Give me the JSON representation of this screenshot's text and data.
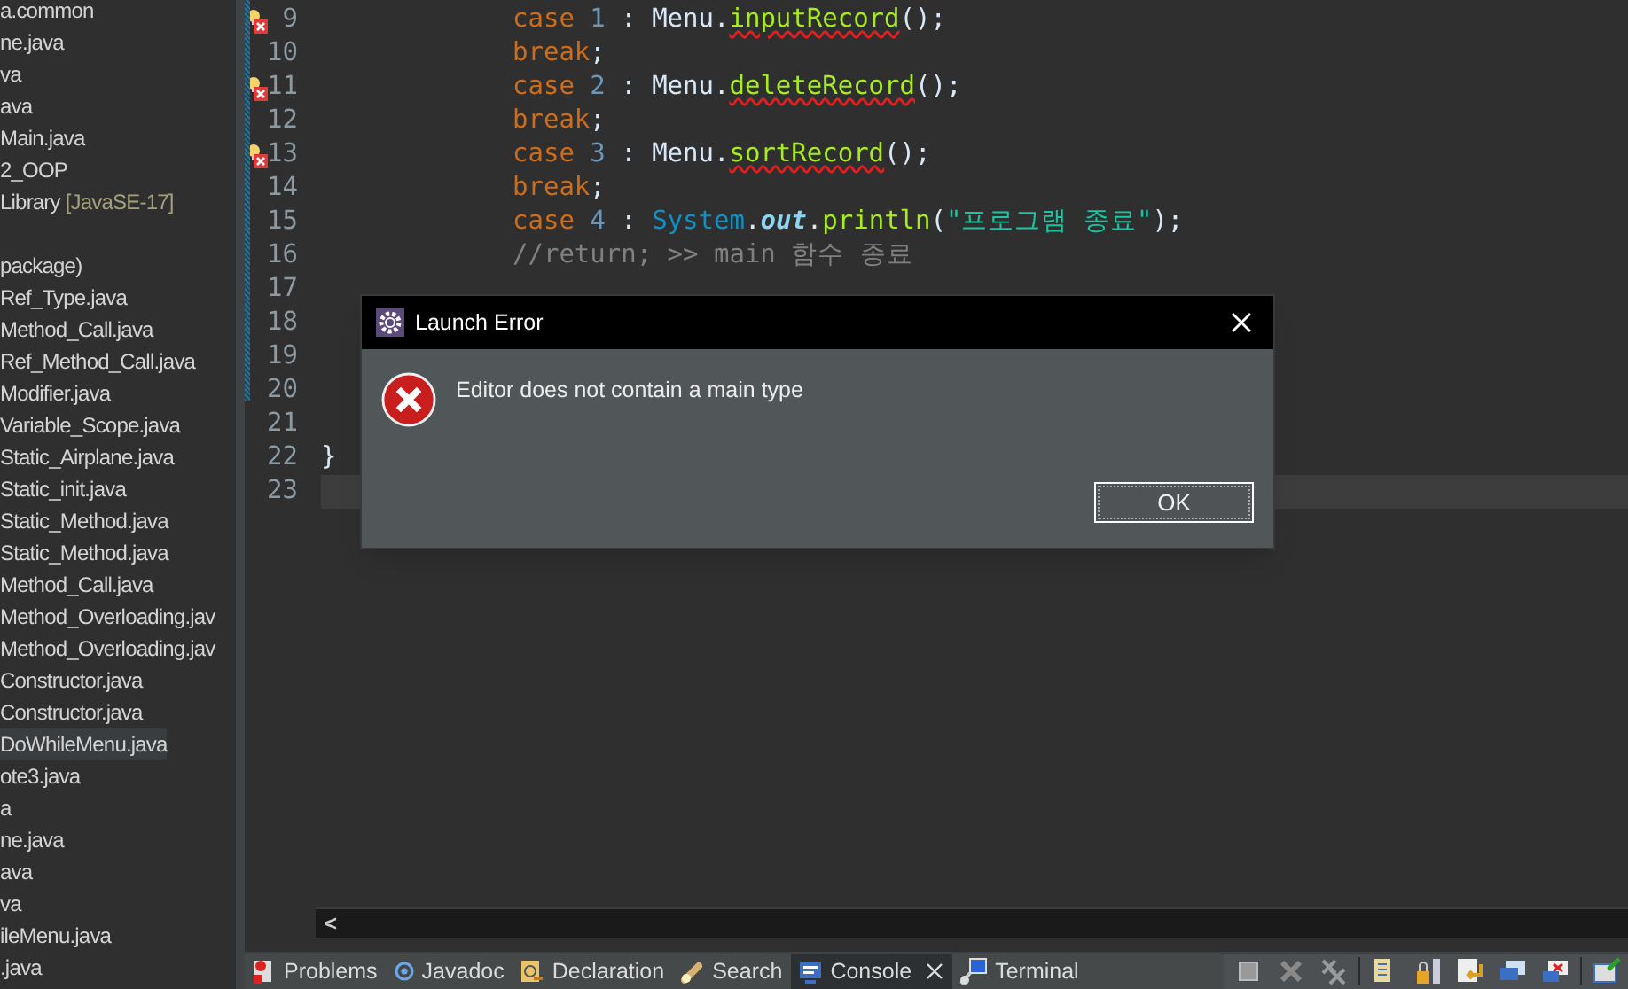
{
  "sidebar": {
    "items": [
      {
        "label": "a.common",
        "selected": false
      },
      {
        "label": "ne.java",
        "selected": false
      },
      {
        "label": "va",
        "selected": false
      },
      {
        "label": "ava",
        "selected": false
      },
      {
        "label": "Main.java",
        "selected": false
      },
      {
        "label": "2_OOP",
        "selected": false
      },
      {
        "label": "Library",
        "decoration": "[JavaSE-17]",
        "selected": false
      },
      {
        "label": "package)",
        "selected": false,
        "gap_before": true
      },
      {
        "label": "Ref_Type.java",
        "selected": false
      },
      {
        "label": "Method_Call.java",
        "selected": false
      },
      {
        "label": "Ref_Method_Call.java",
        "selected": false
      },
      {
        "label": "Modifier.java",
        "selected": false
      },
      {
        "label": "Variable_Scope.java",
        "selected": false
      },
      {
        "label": "Static_Airplane.java",
        "selected": false
      },
      {
        "label": "Static_init.java",
        "selected": false
      },
      {
        "label": "Static_Method.java",
        "selected": false
      },
      {
        "label": "Static_Method.java",
        "selected": false
      },
      {
        "label": "Method_Call.java",
        "selected": false
      },
      {
        "label": "Method_Overloading.jav",
        "selected": false
      },
      {
        "label": "Method_Overloading.jav",
        "selected": false
      },
      {
        "label": "Constructor.java",
        "selected": false
      },
      {
        "label": "Constructor.java",
        "selected": false
      },
      {
        "label": "DoWhileMenu.java",
        "selected": true
      },
      {
        "label": "ote3.java",
        "selected": false
      },
      {
        "label": "a",
        "selected": false
      },
      {
        "label": "ne.java",
        "selected": false
      },
      {
        "label": "ava",
        "selected": false
      },
      {
        "label": "va",
        "selected": false
      },
      {
        "label": "ileMenu.java",
        "selected": false
      },
      {
        "label": ".java",
        "selected": false
      }
    ]
  },
  "editor": {
    "lines": [
      {
        "number": "9",
        "error": true,
        "current": false,
        "kind": "body",
        "tokens": [
          {
            "kind": "keyword",
            "text": "case"
          },
          {
            "kind": "number",
            "text": " 1"
          },
          {
            "kind": "plain",
            "text": " : Menu."
          },
          {
            "kind": "method",
            "text": "inputRecord",
            "error": true
          },
          {
            "kind": "plain",
            "text": "();"
          }
        ]
      },
      {
        "number": "10",
        "error": false,
        "current": false,
        "kind": "body",
        "tokens": [
          {
            "kind": "keyword",
            "text": "break"
          },
          {
            "kind": "plain",
            "text": ";"
          }
        ]
      },
      {
        "number": "11",
        "error": true,
        "current": false,
        "kind": "body",
        "tokens": [
          {
            "kind": "keyword",
            "text": "case"
          },
          {
            "kind": "number",
            "text": " 2"
          },
          {
            "kind": "plain",
            "text": " : Menu."
          },
          {
            "kind": "method",
            "text": "deleteRecord",
            "error": true
          },
          {
            "kind": "plain",
            "text": "();"
          }
        ]
      },
      {
        "number": "12",
        "error": false,
        "current": false,
        "kind": "body",
        "tokens": [
          {
            "kind": "keyword",
            "text": "break"
          },
          {
            "kind": "plain",
            "text": ";"
          }
        ]
      },
      {
        "number": "13",
        "error": true,
        "current": false,
        "kind": "body",
        "tokens": [
          {
            "kind": "keyword",
            "text": "case"
          },
          {
            "kind": "number",
            "text": " 3"
          },
          {
            "kind": "plain",
            "text": " : Menu."
          },
          {
            "kind": "method",
            "text": "sortRecord",
            "error": true
          },
          {
            "kind": "plain",
            "text": "();"
          }
        ]
      },
      {
        "number": "14",
        "error": false,
        "current": false,
        "kind": "body",
        "tokens": [
          {
            "kind": "keyword",
            "text": "break"
          },
          {
            "kind": "plain",
            "text": ";"
          }
        ]
      },
      {
        "number": "15",
        "error": false,
        "current": false,
        "kind": "body",
        "tokens": [
          {
            "kind": "keyword",
            "text": "case"
          },
          {
            "kind": "number",
            "text": " 4"
          },
          {
            "kind": "plain",
            "text": " : "
          },
          {
            "kind": "class",
            "text": "System"
          },
          {
            "kind": "plain",
            "text": "."
          },
          {
            "kind": "field",
            "text": "out"
          },
          {
            "kind": "plain",
            "text": "."
          },
          {
            "kind": "method",
            "text": "println",
            "error": false
          },
          {
            "kind": "plain",
            "text": "("
          },
          {
            "kind": "string",
            "text": "\"프로그램 종료\""
          },
          {
            "kind": "plain",
            "text": ");"
          }
        ]
      },
      {
        "number": "16",
        "error": false,
        "current": false,
        "kind": "body",
        "tokens": [
          {
            "kind": "comment",
            "text": "//return; >> main 함수 종료"
          }
        ]
      },
      {
        "number": "17",
        "error": false,
        "current": false
      },
      {
        "number": "18",
        "error": false,
        "current": false
      },
      {
        "number": "19",
        "error": false,
        "current": false
      },
      {
        "number": "20",
        "error": false,
        "current": false
      },
      {
        "number": "21",
        "error": false,
        "current": false
      },
      {
        "number": "22",
        "error": false,
        "current": false,
        "kind": "close",
        "tokens": [
          {
            "kind": "plain",
            "text": "}"
          }
        ]
      },
      {
        "number": "23",
        "error": false,
        "current": true
      }
    ],
    "scroll_left": "<"
  },
  "panel_tabs": [
    {
      "label": "Problems",
      "selected": false,
      "closable": false
    },
    {
      "label": "Javadoc",
      "selected": false,
      "closable": false
    },
    {
      "label": "Declaration",
      "selected": false,
      "closable": false
    },
    {
      "label": "Search",
      "selected": false,
      "closable": false
    },
    {
      "label": "Console",
      "selected": true,
      "closable": true
    },
    {
      "label": "Terminal",
      "selected": false,
      "closable": false
    }
  ],
  "dialog": {
    "title": "Launch Error",
    "message": "Editor does not contain a main type",
    "buttons": [
      "OK"
    ]
  }
}
